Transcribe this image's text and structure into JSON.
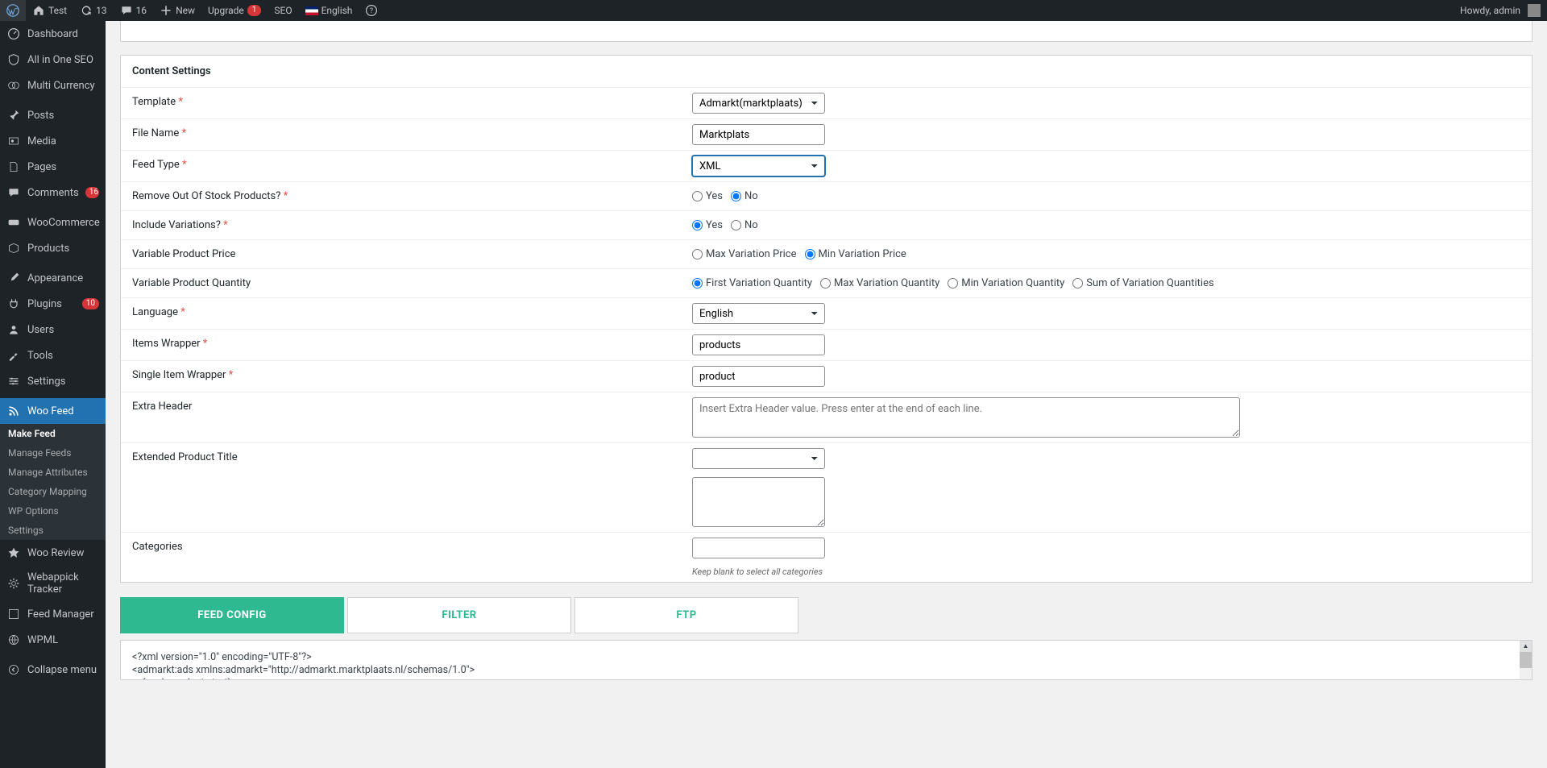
{
  "adminbar": {
    "site": "Test",
    "refresh": "13",
    "comments": "16",
    "new": "New",
    "upgrade": "Upgrade",
    "upgrade_badge": "1",
    "seo": "SEO",
    "lang": "English",
    "howdy": "Howdy, admin"
  },
  "sidebar": {
    "dashboard": "Dashboard",
    "aioseo": "All in One SEO",
    "multicurrency": "Multi Currency",
    "posts": "Posts",
    "media": "Media",
    "pages": "Pages",
    "comments": "Comments",
    "comments_badge": "16",
    "woocommerce": "WooCommerce",
    "products": "Products",
    "appearance": "Appearance",
    "plugins": "Plugins",
    "plugins_badge": "10",
    "users": "Users",
    "tools": "Tools",
    "settings": "Settings",
    "woofeed": "Woo Feed",
    "wooreview": "Woo Review",
    "webappick": "Webappick Tracker",
    "feedmanager": "Feed Manager",
    "wpml": "WPML",
    "collapse": "Collapse menu",
    "sub": {
      "makefeed": "Make Feed",
      "managefeeds": "Manage Feeds",
      "manageattrs": "Manage Attributes",
      "catmap": "Category Mapping",
      "wpoptions": "WP Options",
      "settings": "Settings"
    }
  },
  "form": {
    "section_title": "Content Settings",
    "template_label": "Template",
    "template_value": "Admarkt(marktplaats)",
    "filename_label": "File Name",
    "filename_value": "Marktplats",
    "feedtype_label": "Feed Type",
    "feedtype_value": "XML",
    "removeoos_label": "Remove Out Of Stock Products?",
    "includevar_label": "Include Variations?",
    "varprice_label": "Variable Product Price",
    "varqty_label": "Variable Product Quantity",
    "language_label": "Language",
    "language_value": "English",
    "itemswrap_label": "Items Wrapper",
    "itemswrap_value": "products",
    "singlewrap_label": "Single Item Wrapper",
    "singlewrap_value": "product",
    "extraheader_label": "Extra Header",
    "extraheader_placeholder": "Insert Extra Header value. Press enter at the end of each line.",
    "exttitle_label": "Extended Product Title",
    "categories_label": "Categories",
    "categories_help": "Keep blank to select all categories",
    "yes": "Yes",
    "no": "No",
    "maxvarprice": "Max Variation Price",
    "minvarprice": "Min Variation Price",
    "firstvarqty": "First Variation Quantity",
    "maxvarqty": "Max Variation Quantity",
    "minvarqty": "Min Variation Quantity",
    "sumvarqty": "Sum of Variation Quantities"
  },
  "tabs": {
    "feedconfig": "FEED CONFIG",
    "filter": "FILTER",
    "ftp": "FTP"
  },
  "code": "<?xml version=\"1.0\" encoding=\"UTF-8\"?>\n<admarkt:ads xmlns:admarkt=\"http://admarkt.marktplaats.nl/schemas/1.0\">\n    {each product start}"
}
